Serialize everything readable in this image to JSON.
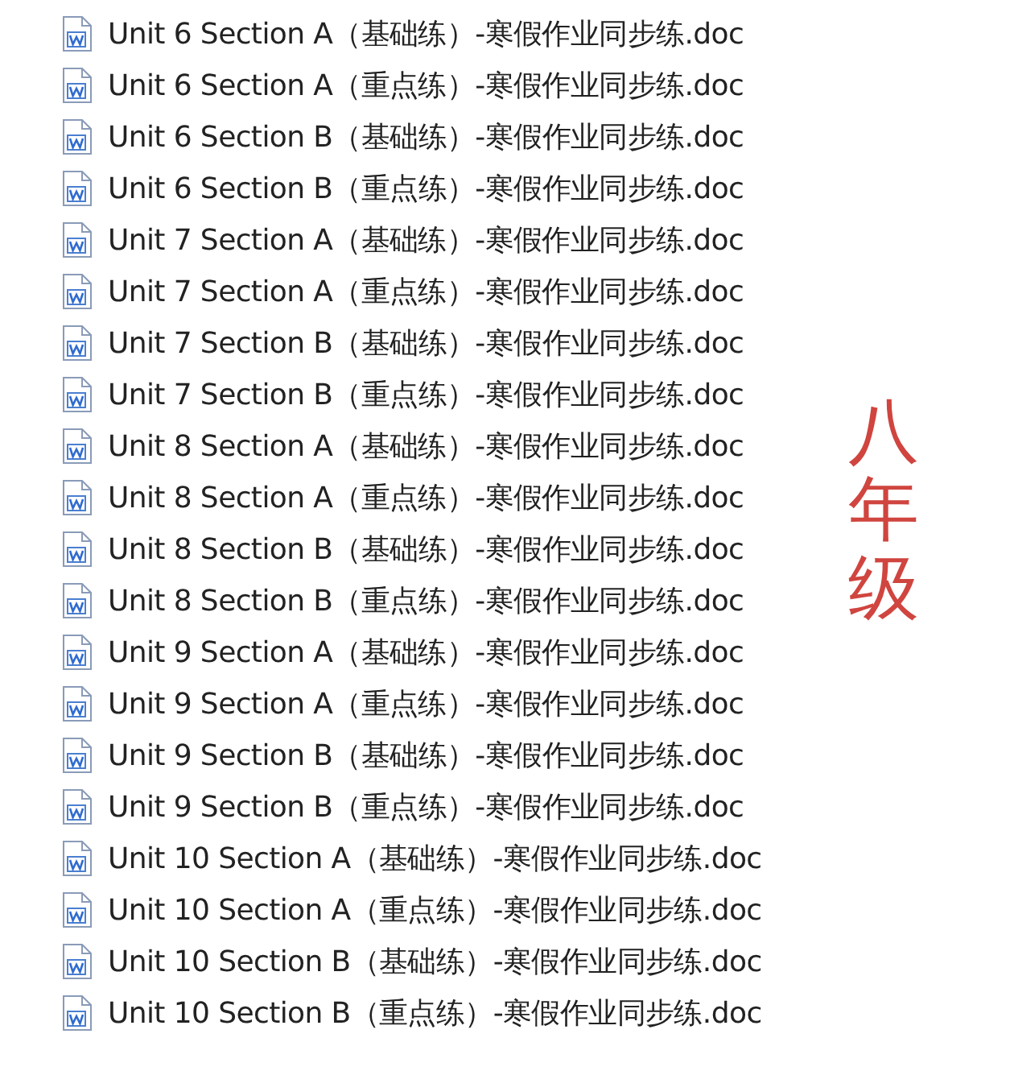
{
  "files": [
    {
      "name": "Unit 6 Section A（基础练）-寒假作业同步练.doc"
    },
    {
      "name": "Unit 6 Section A（重点练）-寒假作业同步练.doc"
    },
    {
      "name": "Unit 6 Section B（基础练）-寒假作业同步练.doc"
    },
    {
      "name": "Unit 6 Section B（重点练）-寒假作业同步练.doc"
    },
    {
      "name": "Unit 7 Section A（基础练）-寒假作业同步练.doc"
    },
    {
      "name": "Unit 7 Section A（重点练）-寒假作业同步练.doc"
    },
    {
      "name": "Unit 7 Section B（基础练）-寒假作业同步练.doc"
    },
    {
      "name": "Unit 7 Section B（重点练）-寒假作业同步练.doc"
    },
    {
      "name": "Unit 8 Section A（基础练）-寒假作业同步练.doc"
    },
    {
      "name": "Unit 8 Section A（重点练）-寒假作业同步练.doc"
    },
    {
      "name": "Unit 8 Section B（基础练）-寒假作业同步练.doc"
    },
    {
      "name": "Unit 8 Section B（重点练）-寒假作业同步练.doc"
    },
    {
      "name": "Unit 9 Section A（基础练）-寒假作业同步练.doc"
    },
    {
      "name": "Unit 9 Section A（重点练）-寒假作业同步练.doc"
    },
    {
      "name": "Unit 9 Section B（基础练）-寒假作业同步练.doc"
    },
    {
      "name": "Unit 9 Section B（重点练）-寒假作业同步练.doc"
    },
    {
      "name": "Unit 10 Section A（基础练）-寒假作业同步练.doc"
    },
    {
      "name": "Unit 10 Section A（重点练）-寒假作业同步练.doc"
    },
    {
      "name": "Unit 10 Section B（基础练）-寒假作业同步练.doc"
    },
    {
      "name": "Unit 10 Section B（重点练）-寒假作业同步练.doc"
    }
  ],
  "grade_label": "八年级"
}
